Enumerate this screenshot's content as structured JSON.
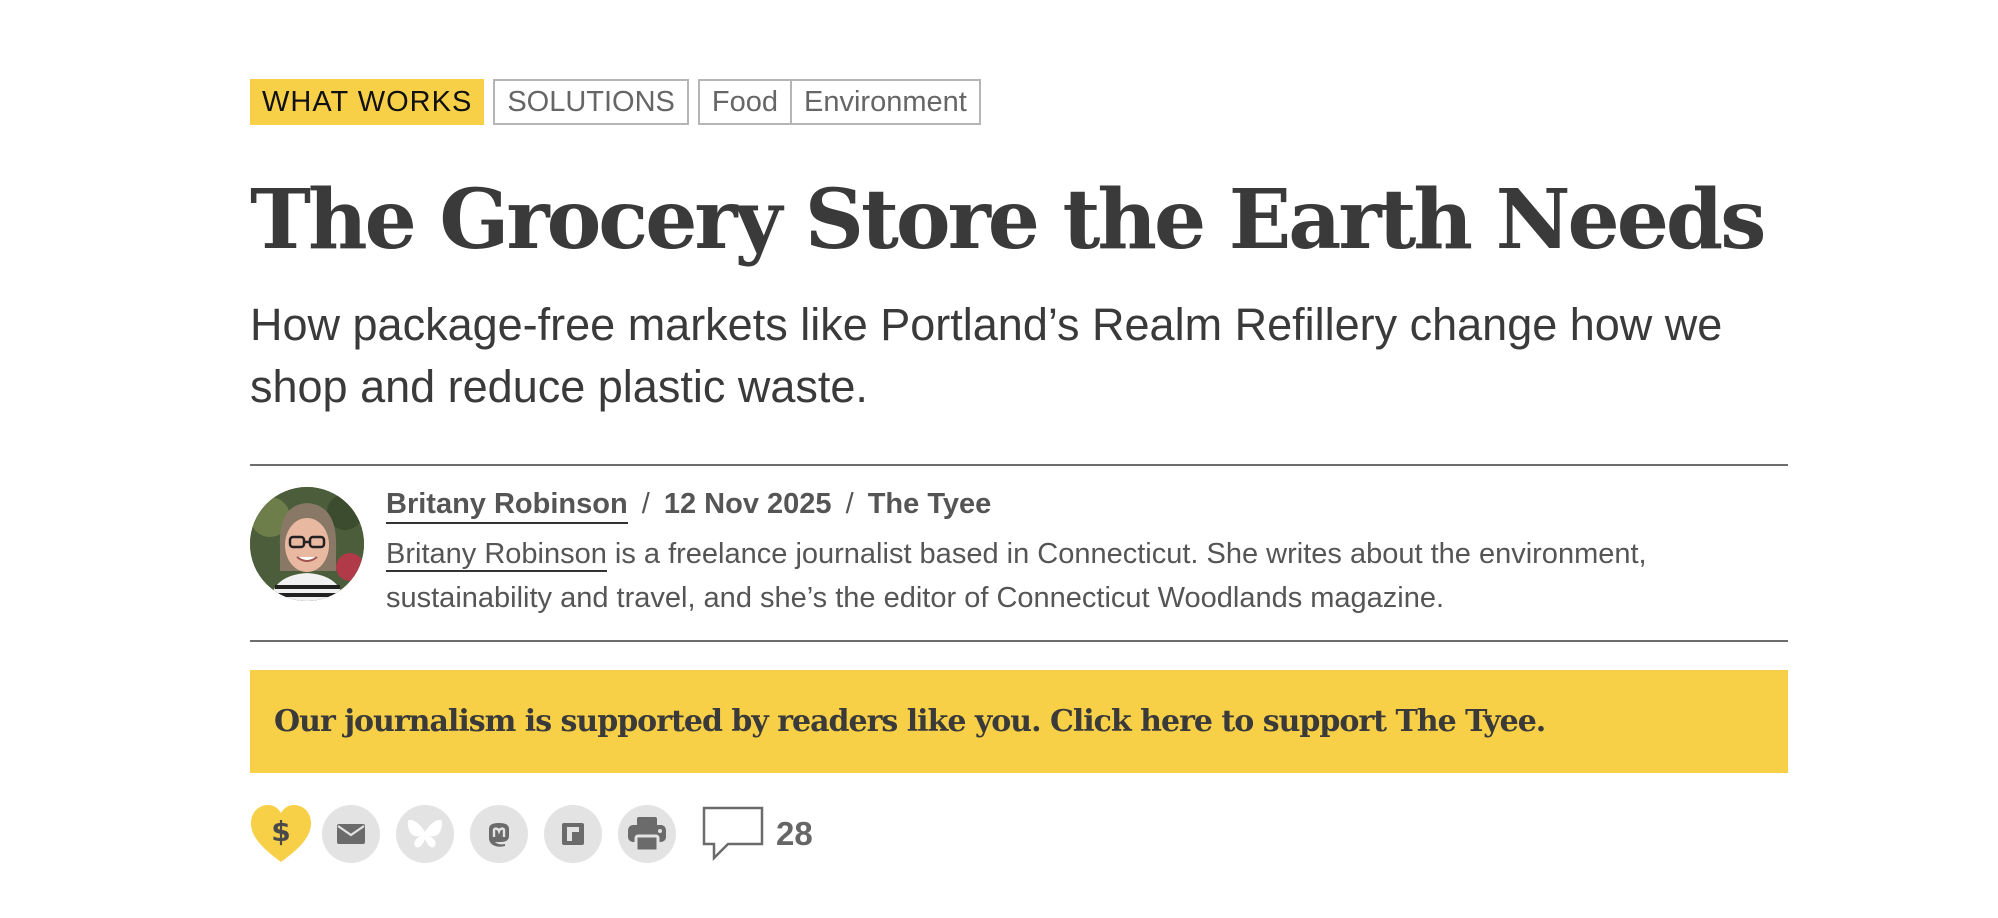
{
  "tags": {
    "primary": "WHAT WORKS",
    "secondary": "SOLUTIONS",
    "topics": [
      "Food",
      "Environment"
    ]
  },
  "article": {
    "headline": "The Grocery Store the Earth Needs",
    "dek": "How package-free markets like Portland’s Realm Refillery change how we shop and reduce plastic waste."
  },
  "byline": {
    "author": "Britany Robinson",
    "separator": "/",
    "date": "12 Nov 2025",
    "publication": "The Tyee",
    "bio_rest": " is a freelance journalist based in Connecticut. She writes about the environment, sustainability and travel, and she’s the editor of Connecticut Woodlands magazine."
  },
  "banner": {
    "text": "Our journalism is supported by readers like you. Click here to support The Tyee."
  },
  "share": {
    "icons": [
      "donate-heart-icon",
      "email-icon",
      "bluesky-icon",
      "mastodon-icon",
      "flipboard-icon",
      "print-icon",
      "comment-icon"
    ],
    "donate_symbol": "$",
    "comment_count": "28"
  },
  "colors": {
    "accent": "#f8d047",
    "text": "#3a3a3a",
    "muted": "#555555",
    "icon_bg": "#e3e3e3",
    "icon_fg": "#6b6b6b"
  }
}
